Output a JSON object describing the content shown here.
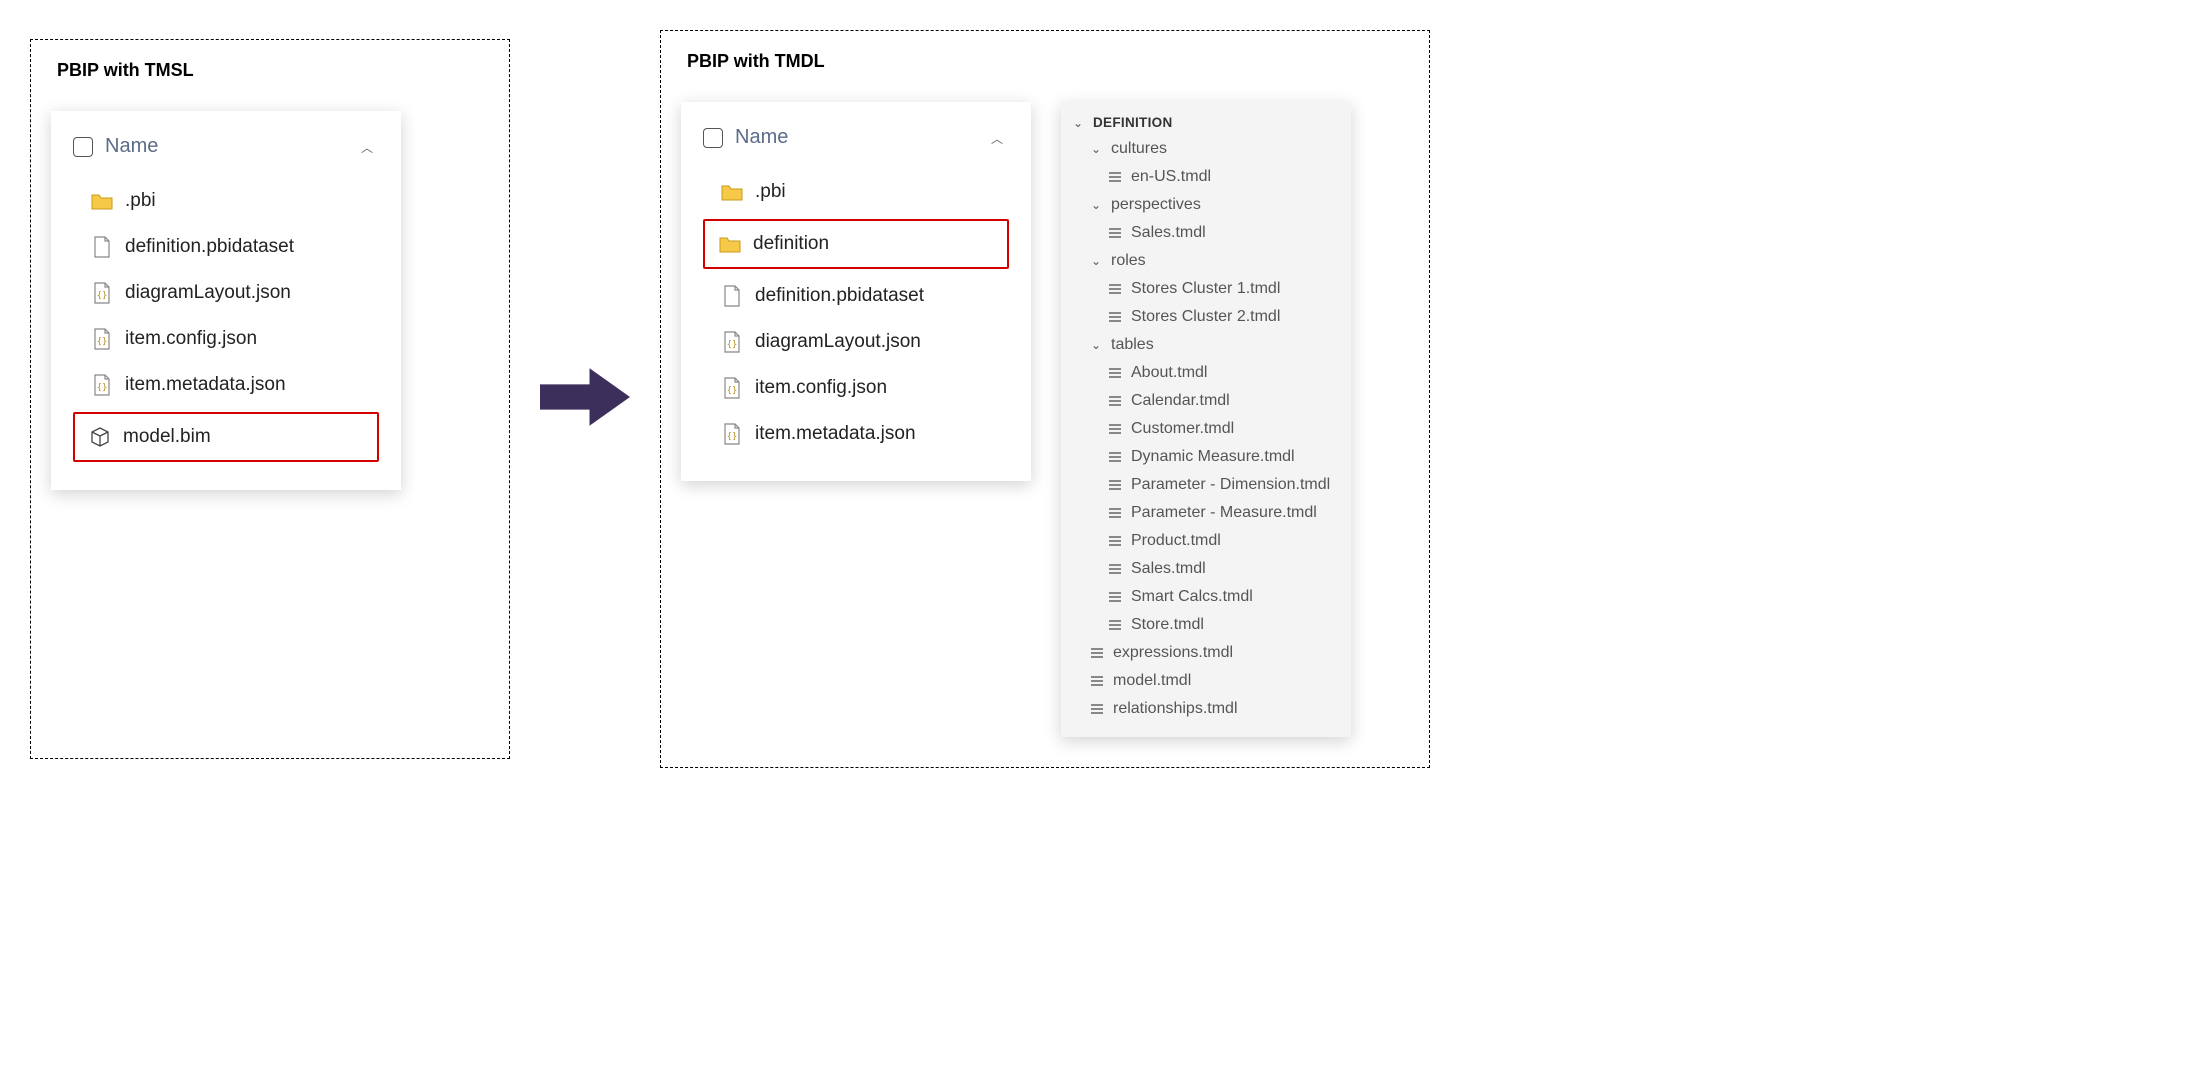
{
  "left": {
    "title": "PBIP with TMSL",
    "name_column": "Name",
    "files": [
      {
        "icon": "folder",
        "name": ".pbi",
        "highlight": false
      },
      {
        "icon": "file",
        "name": "definition.pbidataset",
        "highlight": false
      },
      {
        "icon": "json",
        "name": "diagramLayout.json",
        "highlight": false
      },
      {
        "icon": "json",
        "name": "item.config.json",
        "highlight": false
      },
      {
        "icon": "json",
        "name": "item.metadata.json",
        "highlight": false
      },
      {
        "icon": "cube",
        "name": "model.bim",
        "highlight": true
      }
    ]
  },
  "right": {
    "title": "PBIP with TMDL",
    "name_column": "Name",
    "files": [
      {
        "icon": "folder",
        "name": ".pbi",
        "highlight": false
      },
      {
        "icon": "folder",
        "name": "definition",
        "highlight": true
      },
      {
        "icon": "file",
        "name": "definition.pbidataset",
        "highlight": false
      },
      {
        "icon": "json",
        "name": "diagramLayout.json",
        "highlight": false
      },
      {
        "icon": "json",
        "name": "item.config.json",
        "highlight": false
      },
      {
        "icon": "json",
        "name": "item.metadata.json",
        "highlight": false
      }
    ],
    "tree": {
      "root": "DEFINITION",
      "folders": [
        {
          "name": "cultures",
          "files": [
            "en-US.tmdl"
          ]
        },
        {
          "name": "perspectives",
          "files": [
            "Sales.tmdl"
          ]
        },
        {
          "name": "roles",
          "files": [
            "Stores Cluster 1.tmdl",
            "Stores Cluster 2.tmdl"
          ]
        },
        {
          "name": "tables",
          "files": [
            "About.tmdl",
            "Calendar.tmdl",
            "Customer.tmdl",
            "Dynamic Measure.tmdl",
            "Parameter - Dimension.tmdl",
            "Parameter - Measure.tmdl",
            "Product.tmdl",
            "Sales.tmdl",
            "Smart Calcs.tmdl",
            "Store.tmdl"
          ]
        }
      ],
      "files": [
        "expressions.tmdl",
        "model.tmdl",
        "relationships.tmdl"
      ]
    }
  },
  "colors": {
    "arrow": "#3d2f5b",
    "highlight_border": "#d40000",
    "folder_fill": "#f7c948",
    "header_text": "#5b6b8a"
  }
}
